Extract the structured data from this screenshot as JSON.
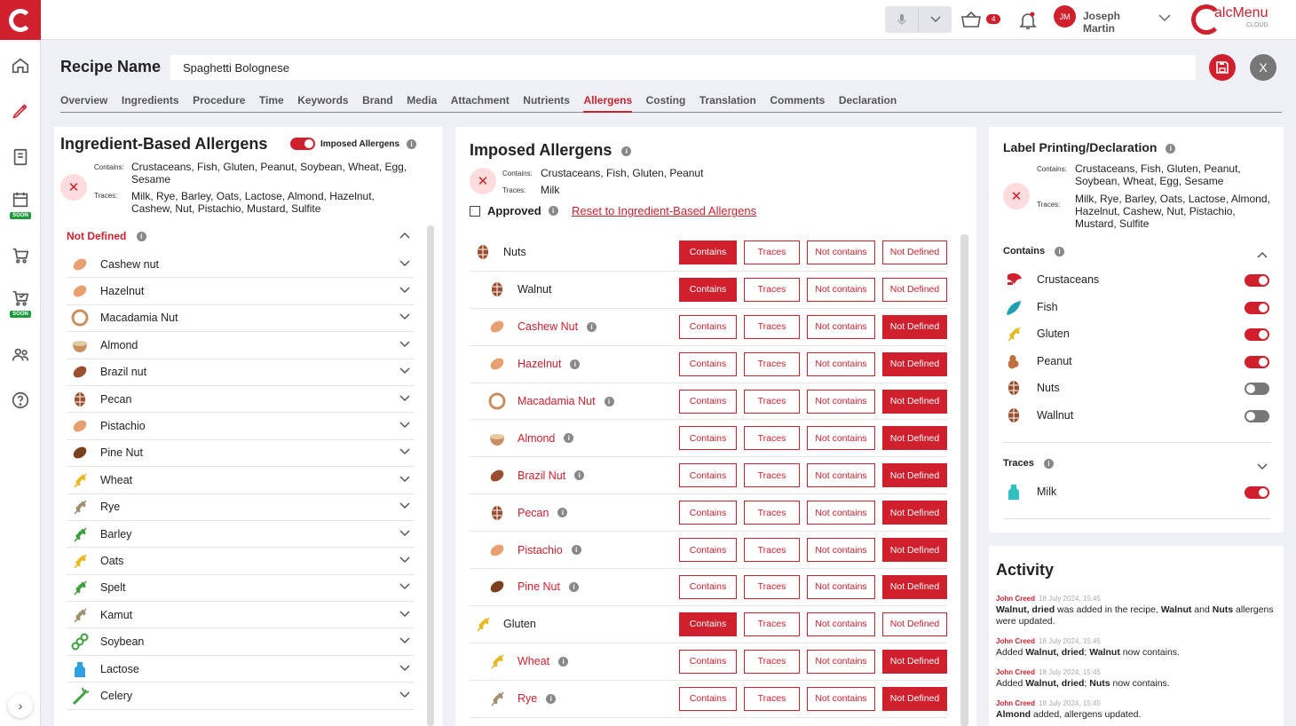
{
  "sidebar": {
    "soon_label": "SOON"
  },
  "topbar": {
    "cart_count": "4",
    "user_initials": "JM",
    "user_first": "Joseph",
    "user_last": "Martin",
    "brand_name": "alcMenu",
    "brand_sub": "CLOUD"
  },
  "recipe": {
    "label": "Recipe Name",
    "value": "Spaghetti Bolognese"
  },
  "tabs": [
    {
      "label": "Overview"
    },
    {
      "label": "Ingredients"
    },
    {
      "label": "Procedure"
    },
    {
      "label": "Time"
    },
    {
      "label": "Keywords"
    },
    {
      "label": "Brand"
    },
    {
      "label": "Media"
    },
    {
      "label": "Attachment"
    },
    {
      "label": "Nutrients"
    },
    {
      "label": "Allergens"
    },
    {
      "label": "Costing"
    },
    {
      "label": "Translation"
    },
    {
      "label": "Comments"
    },
    {
      "label": "Declaration"
    }
  ],
  "active_tab": "Allergens",
  "ingredient_panel": {
    "title": "Ingredient-Based Allergens",
    "toggle_label": "Imposed Allergens",
    "contains_label": "Contains:",
    "contains_value": "Crustaceans, Fish, Gluten, Peanut, Soybean, Wheat, Egg, Sesame",
    "traces_label": "Traces:",
    "traces_value": "Milk, Rye, Barley, Oats, Lactose, Almond, Hazelnut, Cashew, Nut, Pistachio, Mustard, Sulfite",
    "section_title": "Not Defined",
    "items": [
      {
        "name": "Cashew nut",
        "icon": "cashew-icon",
        "color": "#e8a070"
      },
      {
        "name": "Hazelnut",
        "icon": "hazelnut-icon",
        "color": "#e8a070"
      },
      {
        "name": "Macadamia Nut",
        "icon": "macadamia-icon",
        "color": "#c89060"
      },
      {
        "name": "Almond",
        "icon": "almond-icon",
        "color": "#c89060"
      },
      {
        "name": "Brazil nut",
        "icon": "brazil-nut-icon",
        "color": "#9a5030"
      },
      {
        "name": "Pecan",
        "icon": "pecan-icon",
        "color": "#9a5030"
      },
      {
        "name": "Pistachio",
        "icon": "pistachio-icon",
        "color": "#e8a070"
      },
      {
        "name": "Pine Nut",
        "icon": "pine-nut-icon",
        "color": "#7a4020"
      },
      {
        "name": "Wheat",
        "icon": "wheat-icon",
        "color": "#e8b820"
      },
      {
        "name": "Rye",
        "icon": "rye-icon",
        "color": "#a09070"
      },
      {
        "name": "Barley",
        "icon": "barley-icon",
        "color": "#40a040"
      },
      {
        "name": "Oats",
        "icon": "oats-icon",
        "color": "#e8b820"
      },
      {
        "name": "Spelt",
        "icon": "spelt-icon",
        "color": "#40a040"
      },
      {
        "name": "Kamut",
        "icon": "kamut-icon",
        "color": "#a09070"
      },
      {
        "name": "Soybean",
        "icon": "soybean-icon",
        "color": "#40a040"
      },
      {
        "name": "Lactose",
        "icon": "lactose-icon",
        "color": "#30a0e0"
      },
      {
        "name": "Celery",
        "icon": "celery-icon",
        "color": "#40a040"
      }
    ]
  },
  "imposed_panel": {
    "title": "Imposed Allergens",
    "contains_label": "Contains:",
    "contains_value": "Crustaceans, Fish, Gluten, Peanut",
    "traces_label": "Traces:",
    "traces_value": "Milk",
    "approved_label": "Approved",
    "reset_label": "Reset to Ingredient-Based Allergens",
    "buttons": {
      "contains": "Contains",
      "traces": "Traces",
      "not_contains": "Not contains",
      "not_defined": "Not Defined"
    },
    "rows": [
      {
        "name": "Nuts",
        "level": "group",
        "icon": "nuts-icon",
        "color": "#9a5030",
        "selected": "contains"
      },
      {
        "name": "Walnut",
        "level": "sub",
        "icon": "walnut-icon",
        "color": "#9a5030",
        "selected": "contains"
      },
      {
        "name": "Cashew Nut",
        "level": "sub",
        "icon": "cashew-icon",
        "color": "#e8a070",
        "selected": "not_defined"
      },
      {
        "name": "Hazelnut",
        "level": "sub",
        "icon": "hazelnut-icon",
        "color": "#e8a070",
        "selected": "not_defined"
      },
      {
        "name": "Macadamia Nut",
        "level": "sub",
        "icon": "macadamia-icon",
        "color": "#c89060",
        "selected": "not_defined"
      },
      {
        "name": "Almond",
        "level": "sub",
        "icon": "almond-icon",
        "color": "#c89060",
        "selected": "not_defined"
      },
      {
        "name": "Brazil Nut",
        "level": "sub",
        "icon": "brazil-nut-icon",
        "color": "#9a5030",
        "selected": "not_defined"
      },
      {
        "name": "Pecan",
        "level": "sub",
        "icon": "pecan-icon",
        "color": "#9a5030",
        "selected": "not_defined"
      },
      {
        "name": "Pistachio",
        "level": "sub",
        "icon": "pistachio-icon",
        "color": "#e8a070",
        "selected": "not_defined"
      },
      {
        "name": "Pine Nut",
        "level": "sub",
        "icon": "pine-nut-icon",
        "color": "#7a4020",
        "selected": "not_defined"
      },
      {
        "name": "Gluten",
        "level": "group",
        "icon": "gluten-icon",
        "color": "#e8b820",
        "selected": "contains"
      },
      {
        "name": "Wheat",
        "level": "sub",
        "icon": "wheat-icon",
        "color": "#e8b820",
        "selected": "not_defined"
      },
      {
        "name": "Rye",
        "level": "sub",
        "icon": "rye-icon",
        "color": "#a09070",
        "selected": "not_defined"
      }
    ]
  },
  "label_panel": {
    "title": "Label Printing/Declaration",
    "contains_label": "Contains:",
    "contains_value": "Crustaceans, Fish, Gluten, Peanut, Soybean, Wheat, Egg, Sesame",
    "traces_label": "Traces:",
    "traces_value": "Milk, Rye, Barley, Oats, Lactose, Almond, Hazelnut, Cashew, Nut, Pistachio, Mustard, Sulfite",
    "contains_section": "Contains",
    "traces_section": "Traces",
    "contains_items": [
      {
        "name": "Crustaceans",
        "icon": "crustaceans-icon",
        "color": "#d0202e",
        "on": true
      },
      {
        "name": "Fish",
        "icon": "fish-icon",
        "color": "#20a0b0",
        "on": true
      },
      {
        "name": "Gluten",
        "icon": "gluten-icon",
        "color": "#e8b820",
        "on": true
      },
      {
        "name": "Peanut",
        "icon": "peanut-icon",
        "color": "#c07040",
        "on": true
      },
      {
        "name": "Nuts",
        "icon": "nuts-icon",
        "color": "#9a5030",
        "on": false
      },
      {
        "name": "Wallnut",
        "icon": "walnut-icon",
        "color": "#9a5030",
        "on": false
      }
    ],
    "traces_items": [
      {
        "name": "Milk",
        "icon": "milk-icon",
        "color": "#30c0c0",
        "on": true
      }
    ]
  },
  "activity": {
    "title": "Activity",
    "entries": [
      {
        "who": "John Creed",
        "when": "18 July 2024, 15:45",
        "text": "<b>Walnut, dried</b> was added in the recipe, <b>Walnut</b> and <b>Nuts</b> allergens were updated."
      },
      {
        "who": "John Creed",
        "when": "18 July 2024, 15:45",
        "text": "Added <b>Walnut, dried</b>; <b>Walnut</b> now contains."
      },
      {
        "who": "John Creed",
        "when": "18 July 2024, 15:45",
        "text": "Added <b>Walnut, dried</b>; <b>Nuts</b> now contains."
      },
      {
        "who": "John Creed",
        "when": "18 July 2024, 15:45",
        "text": "<b>Almond</b> added, allergens updated."
      }
    ]
  }
}
